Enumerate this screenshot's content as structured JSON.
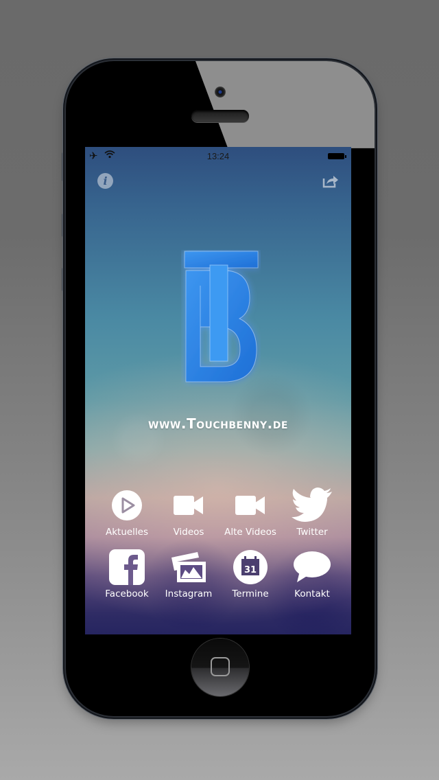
{
  "statusbar": {
    "time": "13:24",
    "airplane_mode": true,
    "wifi": true,
    "battery_percent": 100
  },
  "header": {
    "info_icon": "info-icon",
    "share_icon": "share-icon",
    "info_glyph": "i"
  },
  "logo": {
    "letters": "TB",
    "color": "#2a7fe0"
  },
  "website": "www.Touchbenny.de",
  "menu": [
    {
      "label": "Aktuelles",
      "icon": "play-circle-icon"
    },
    {
      "label": "Videos",
      "icon": "video-camera-icon"
    },
    {
      "label": "Alte Videos",
      "icon": "video-camera-icon"
    },
    {
      "label": "Twitter",
      "icon": "twitter-bird-icon"
    },
    {
      "label": "Facebook",
      "icon": "facebook-icon"
    },
    {
      "label": "Instagram",
      "icon": "photos-icon"
    },
    {
      "label": "Termine",
      "icon": "calendar-icon",
      "calendar_day": "31"
    },
    {
      "label": "Kontakt",
      "icon": "speech-bubble-icon"
    }
  ]
}
